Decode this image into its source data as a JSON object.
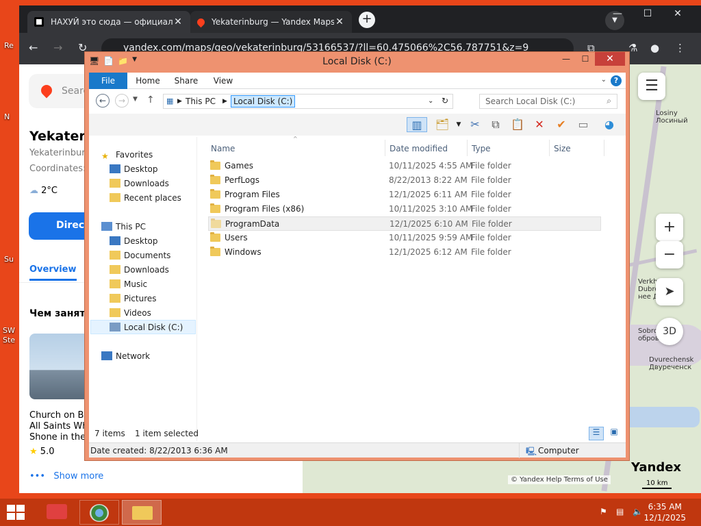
{
  "desktop": {
    "icons": [
      {
        "label": "Re"
      },
      {
        "label": "N"
      },
      {
        "label": "Su"
      },
      {
        "label": "SW"
      },
      {
        "label": "Ste"
      }
    ]
  },
  "browser": {
    "tabs": [
      {
        "title": "НАХУЙ это сюда — официальн",
        "close": "✕"
      },
      {
        "title": "Yekaterinburg — Yandex Maps",
        "close": "✕"
      }
    ],
    "new_tab": "+",
    "url": "yandex.com/maps/geo/yekaterinburg/53166537/?ll=60.475066%2C56.787751&z=9",
    "window_controls": [
      "—",
      "☐",
      "✕"
    ]
  },
  "yandex": {
    "search_placeholder": "Search",
    "title": "Yekaterinburg",
    "subtitle": "Yekaterinburg",
    "coordinates_label": "Coordinates:",
    "weather": "2°C",
    "directions": "Directions",
    "overview_tab": "Overview",
    "section_title": "Чем заняться",
    "card_title_lines": [
      "Church on Bl",
      "All Saints Wh",
      "Shone in the"
    ],
    "rating": "5.0",
    "show_more": "Show more"
  },
  "map": {
    "labels": [
      {
        "text": "Losiny\nЛосиный"
      },
      {
        "text": "Verkhneye\nDubrovo\nнее Дубр"
      },
      {
        "text": "Sobrov\nобровск"
      },
      {
        "text": "Dvurechensk\nДвуреченск"
      }
    ],
    "zoom_in": "+",
    "zoom_out": "−",
    "three_d": "3D",
    "attribution": "© Yandex   Help   Terms of Use",
    "logo": "Yandex",
    "scale": "10 km"
  },
  "explorer": {
    "title": "Local Disk (C:)",
    "ribbon_tabs": [
      "File",
      "Home",
      "Share",
      "View"
    ],
    "breadcrumb": [
      "This PC",
      "Local Disk (C:)"
    ],
    "search_placeholder": "Search Local Disk (C:)",
    "nav": {
      "favorites": "Favorites",
      "favorites_items": [
        "Desktop",
        "Downloads",
        "Recent places"
      ],
      "this_pc": "This PC",
      "this_pc_items": [
        "Desktop",
        "Documents",
        "Downloads",
        "Music",
        "Pictures",
        "Videos",
        "Local Disk (C:)"
      ],
      "network": "Network"
    },
    "columns": [
      "Name",
      "Date modified",
      "Type",
      "Size"
    ],
    "files": [
      {
        "name": "Games",
        "date": "10/11/2025 4:55 AM",
        "type": "File folder"
      },
      {
        "name": "PerfLogs",
        "date": "8/22/2013 8:22 AM",
        "type": "File folder"
      },
      {
        "name": "Program Files",
        "date": "12/1/2025 6:11 AM",
        "type": "File folder"
      },
      {
        "name": "Program Files (x86)",
        "date": "10/11/2025 3:10 AM",
        "type": "File folder"
      },
      {
        "name": "ProgramData",
        "date": "12/1/2025 6:10 AM",
        "type": "File folder"
      },
      {
        "name": "Users",
        "date": "10/11/2025 9:59 AM",
        "type": "File folder"
      },
      {
        "name": "Windows",
        "date": "12/1/2025 6:12 AM",
        "type": "File folder"
      }
    ],
    "item_count": "7 items",
    "selection": "1 item selected",
    "details": "Date created: 8/22/2013 6:36 AM",
    "location": "Computer"
  },
  "taskbar": {
    "time": "6:35 AM",
    "date": "12/1/2025"
  },
  "colors": {
    "desktop": "#e8461a",
    "accent_blue": "#1979ca",
    "explorer_frame": "#ee9270"
  }
}
